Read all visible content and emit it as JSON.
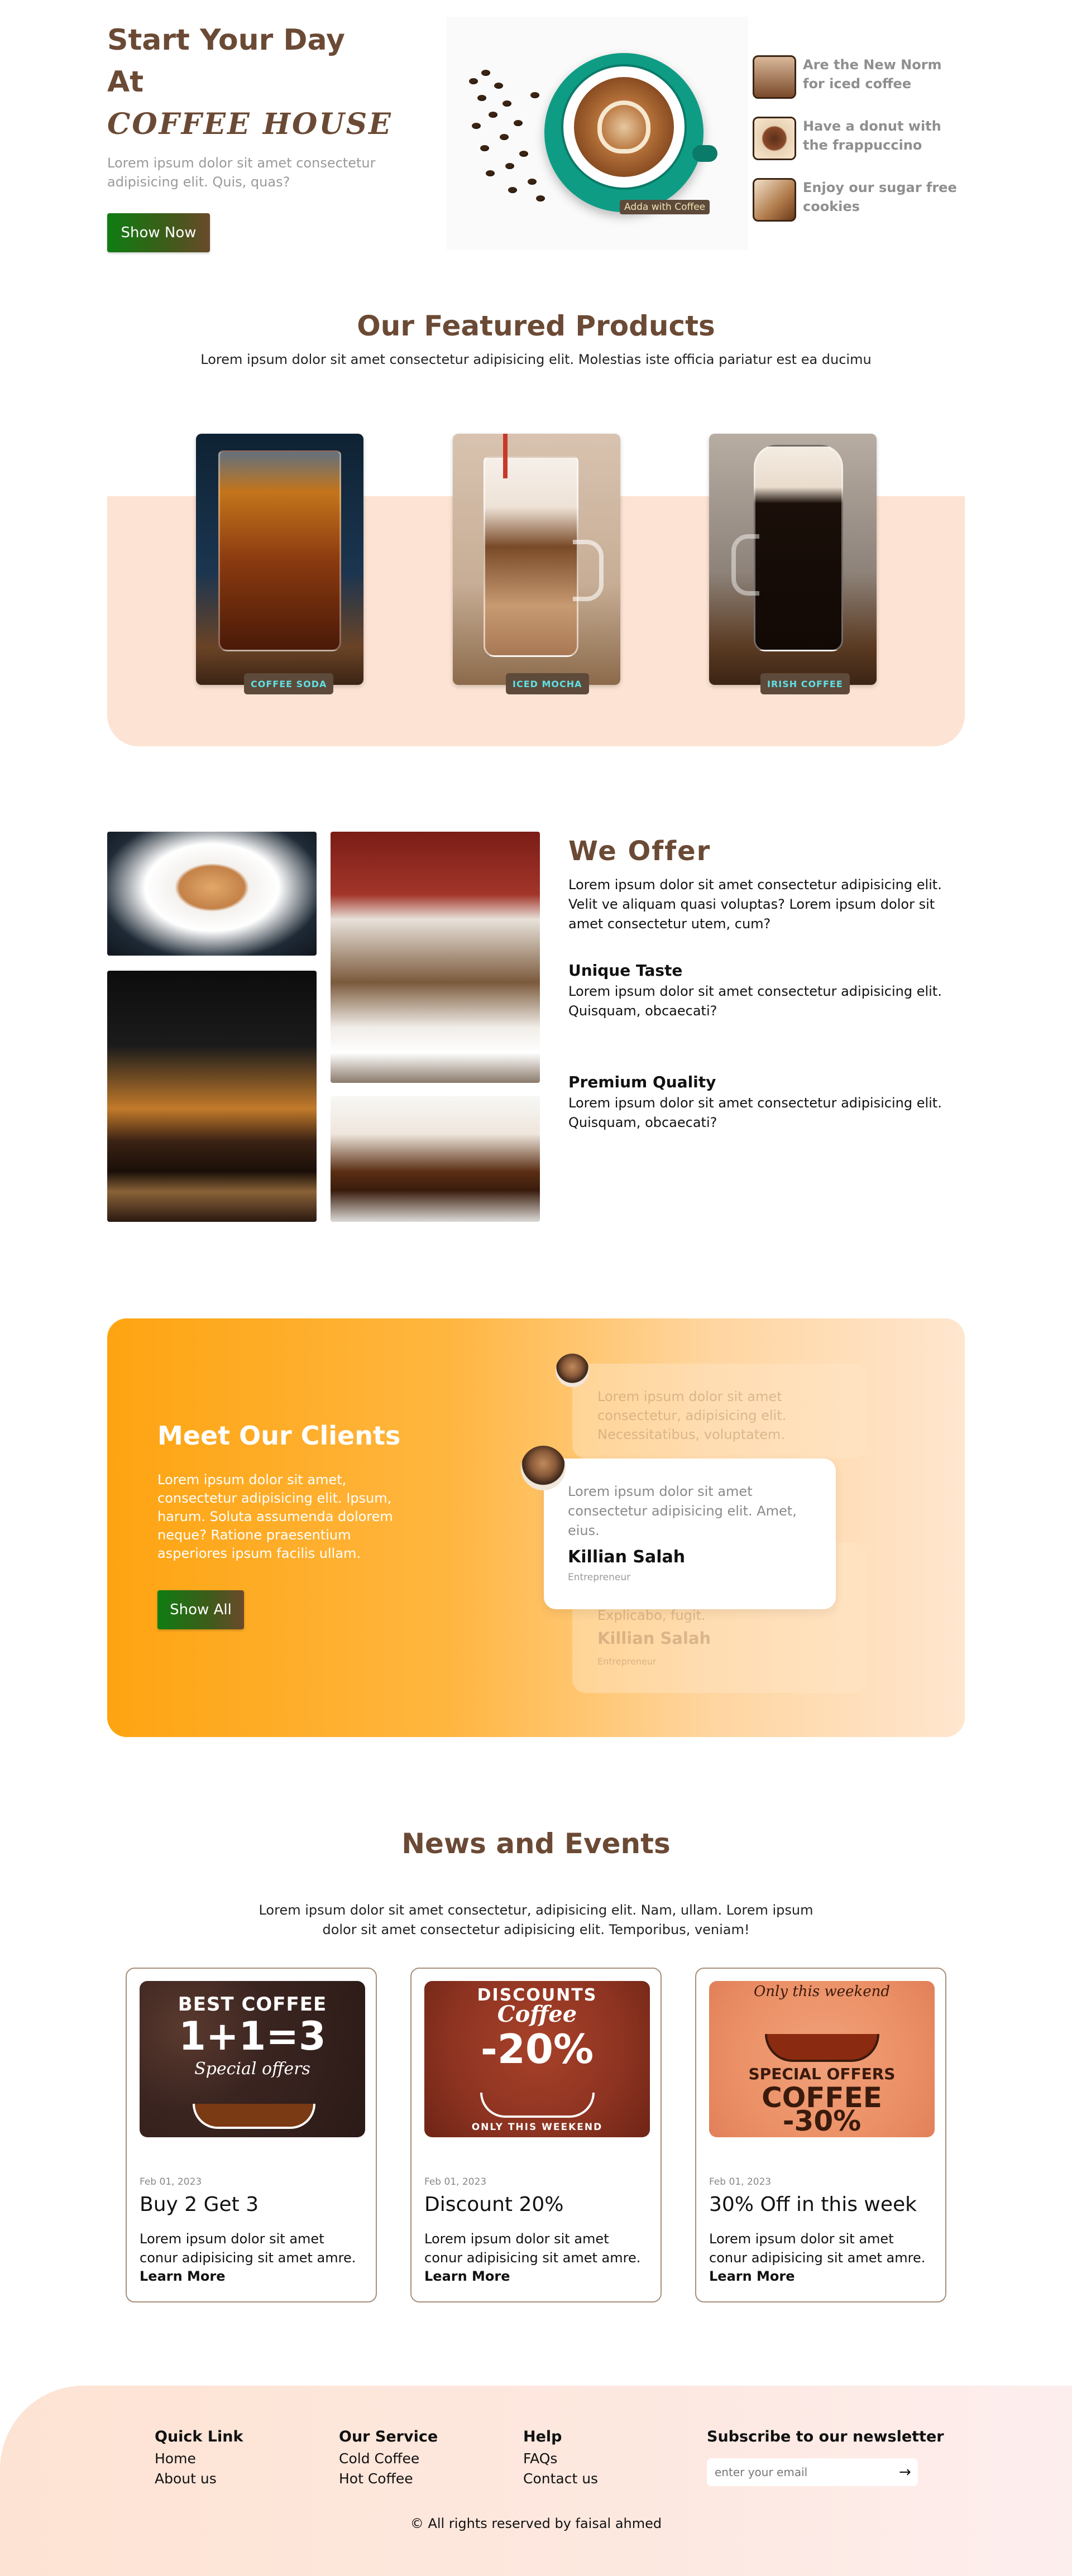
{
  "hero": {
    "title_line1": "Start Your Day",
    "title_line2": "At",
    "brand": "COFFEE HOUSE",
    "description": "Lorem ipsum dolor sit amet consectetur adipisicing elit. Quis, quas?",
    "cta_label": "Show Now",
    "image_tag": "Adda with Coffee",
    "side_items": [
      {
        "text": "Are the New Norm for iced coffee",
        "icon": "iced-coffee-cup-icon"
      },
      {
        "text": "Have a donut with the frappuccino",
        "icon": "donut-icon"
      },
      {
        "text": "Enjoy our sugar free cookies",
        "icon": "cookie-icon"
      }
    ]
  },
  "featured": {
    "title": "Our Featured Products",
    "subtitle": "Lorem ipsum dolor sit amet consectetur adipisicing elit. Molestias iste officia pariatur est ea ducimu",
    "products": [
      {
        "name": "COFFEE SODA"
      },
      {
        "name": "ICED MOCHA"
      },
      {
        "name": "IRISH COFFEE"
      }
    ]
  },
  "offer": {
    "title": "We Offer",
    "intro": "Lorem ipsum dolor sit amet consectetur adipisicing elit. Velit ve aliquam quasi voluptas? Lorem ipsum dolor sit amet consectetur utem, cum?",
    "features": [
      {
        "title": "Unique Taste",
        "text": "Lorem ipsum dolor sit amet consectetur adipisicing elit. Quisquam, obcaecati?"
      },
      {
        "title": "Premium Quality",
        "text": "Lorem ipsum dolor sit amet consectetur adipisicing elit. Quisquam, obcaecati?"
      }
    ]
  },
  "clients": {
    "title": "Meet Our Clients",
    "description": "Lorem ipsum dolor sit amet, consectetur adipisicing elit. Ipsum, harum. Soluta assumenda dolorem neque? Ratione praesentium asperiores ipsum facilis ullam.",
    "cta_label": "Show All",
    "ghost_top_text": "Lorem ipsum dolor sit amet consectetur, adipisicing elit. Necessitatibus, voluptatem.",
    "ghost_bottom_text": "Explicabo, fugit.",
    "ghost_bottom_name": "Killian Salah",
    "ghost_bottom_role": "Entrepreneur",
    "testimonial": {
      "text": "Lorem ipsum dolor sit amet consectetur adipisicing elit. Amet, eius.",
      "name": "Killian Salah",
      "role": "Entrepreneur"
    }
  },
  "news": {
    "title": "News and Events",
    "subtitle": "Lorem ipsum dolor sit amet consectetur, adipisicing elit. Nam, ullam. Lorem ipsum dolor sit amet consectetur adipisicing elit. Temporibus, veniam!",
    "cards": [
      {
        "date": "Feb 01, 2023",
        "headline": "Buy 2 Get 3",
        "body": "Lorem ipsum dolor sit amet conur adipisicing sit amet amre.",
        "link": "Learn More",
        "img_line1": "BEST COFFEE",
        "img_line2": "1+1=3",
        "img_line3": "Special offers"
      },
      {
        "date": "Feb 01, 2023",
        "headline": "Discount 20%",
        "body": "Lorem ipsum dolor sit amet conur adipisicing sit amet amre.",
        "link": "Learn More",
        "img_line1": "DISCOUNTS",
        "img_line2": "Coffee",
        "img_line3": "-20%",
        "img_line4": "ONLY THIS WEEKEND"
      },
      {
        "date": "Feb 01, 2023",
        "headline": "30% Off in this week",
        "body": "Lorem ipsum dolor sit amet conur adipisicing sit amet amre.",
        "link": "Learn More",
        "img_line1": "Only this weekend",
        "img_line2": "SPECIAL OFFERS",
        "img_line3": "COFFEE",
        "img_line4": "-30%"
      }
    ]
  },
  "footer": {
    "quick_link": {
      "title": "Quick Link",
      "links": [
        "Home",
        "About us"
      ]
    },
    "service": {
      "title": "Our Service",
      "links": [
        "Cold Coffee",
        "Hot Coffee"
      ]
    },
    "help": {
      "title": "Help",
      "links": [
        "FAQs",
        "Contact us"
      ]
    },
    "newsletter": {
      "title": "Subscribe to our newsletter",
      "placeholder": "enter your email",
      "icon": "arrow-right-icon"
    },
    "copyright": "© All rights reserved by faisal ahmed"
  },
  "colors": {
    "brand_brown": "#6b4a35",
    "peach": "#fde3d3",
    "orange": "#fea411",
    "green_button": "#0f7d12",
    "tag_cyan": "#5fe0e6"
  }
}
